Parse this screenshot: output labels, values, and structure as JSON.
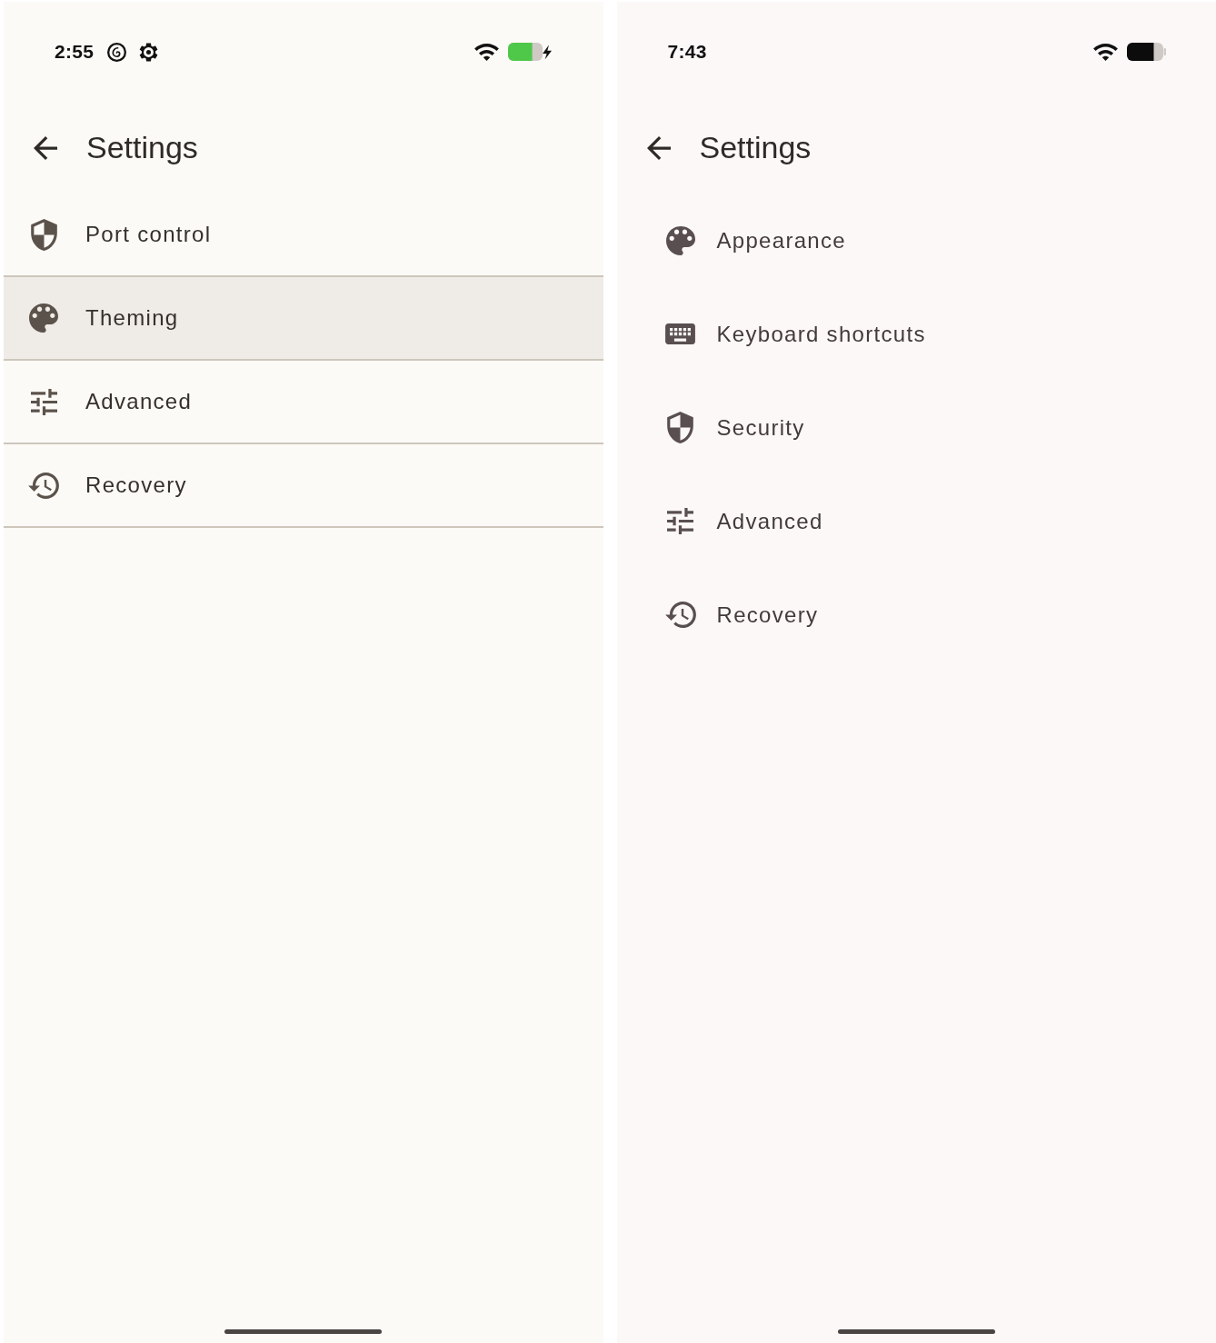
{
  "screens": [
    {
      "kind": "divided",
      "status_bar": {
        "time": "2:55",
        "notifications": [
          {
            "kind": "spiral"
          },
          {
            "kind": "gear"
          }
        ],
        "charging": true
      },
      "app_bar": {
        "title": "Settings"
      },
      "items": [
        {
          "kind": "shield",
          "label": "Port control",
          "selected": false
        },
        {
          "kind": "palette",
          "label": "Theming",
          "selected": true
        },
        {
          "kind": "sliders",
          "label": "Advanced",
          "selected": false
        },
        {
          "kind": "history",
          "label": "Recovery",
          "selected": false
        }
      ]
    },
    {
      "kind": "spaced",
      "status_bar": {
        "time": "7:43",
        "charging": false
      },
      "app_bar": {
        "title": "Settings"
      },
      "items": [
        {
          "kind": "palette",
          "label": "Appearance",
          "selected": false
        },
        {
          "kind": "keyboard",
          "label": "Keyboard shortcuts",
          "selected": false
        },
        {
          "kind": "shield",
          "label": "Security",
          "selected": false
        },
        {
          "kind": "sliders",
          "label": "Advanced",
          "selected": false
        },
        {
          "kind": "history",
          "label": "Recovery",
          "selected": false
        }
      ]
    }
  ]
}
